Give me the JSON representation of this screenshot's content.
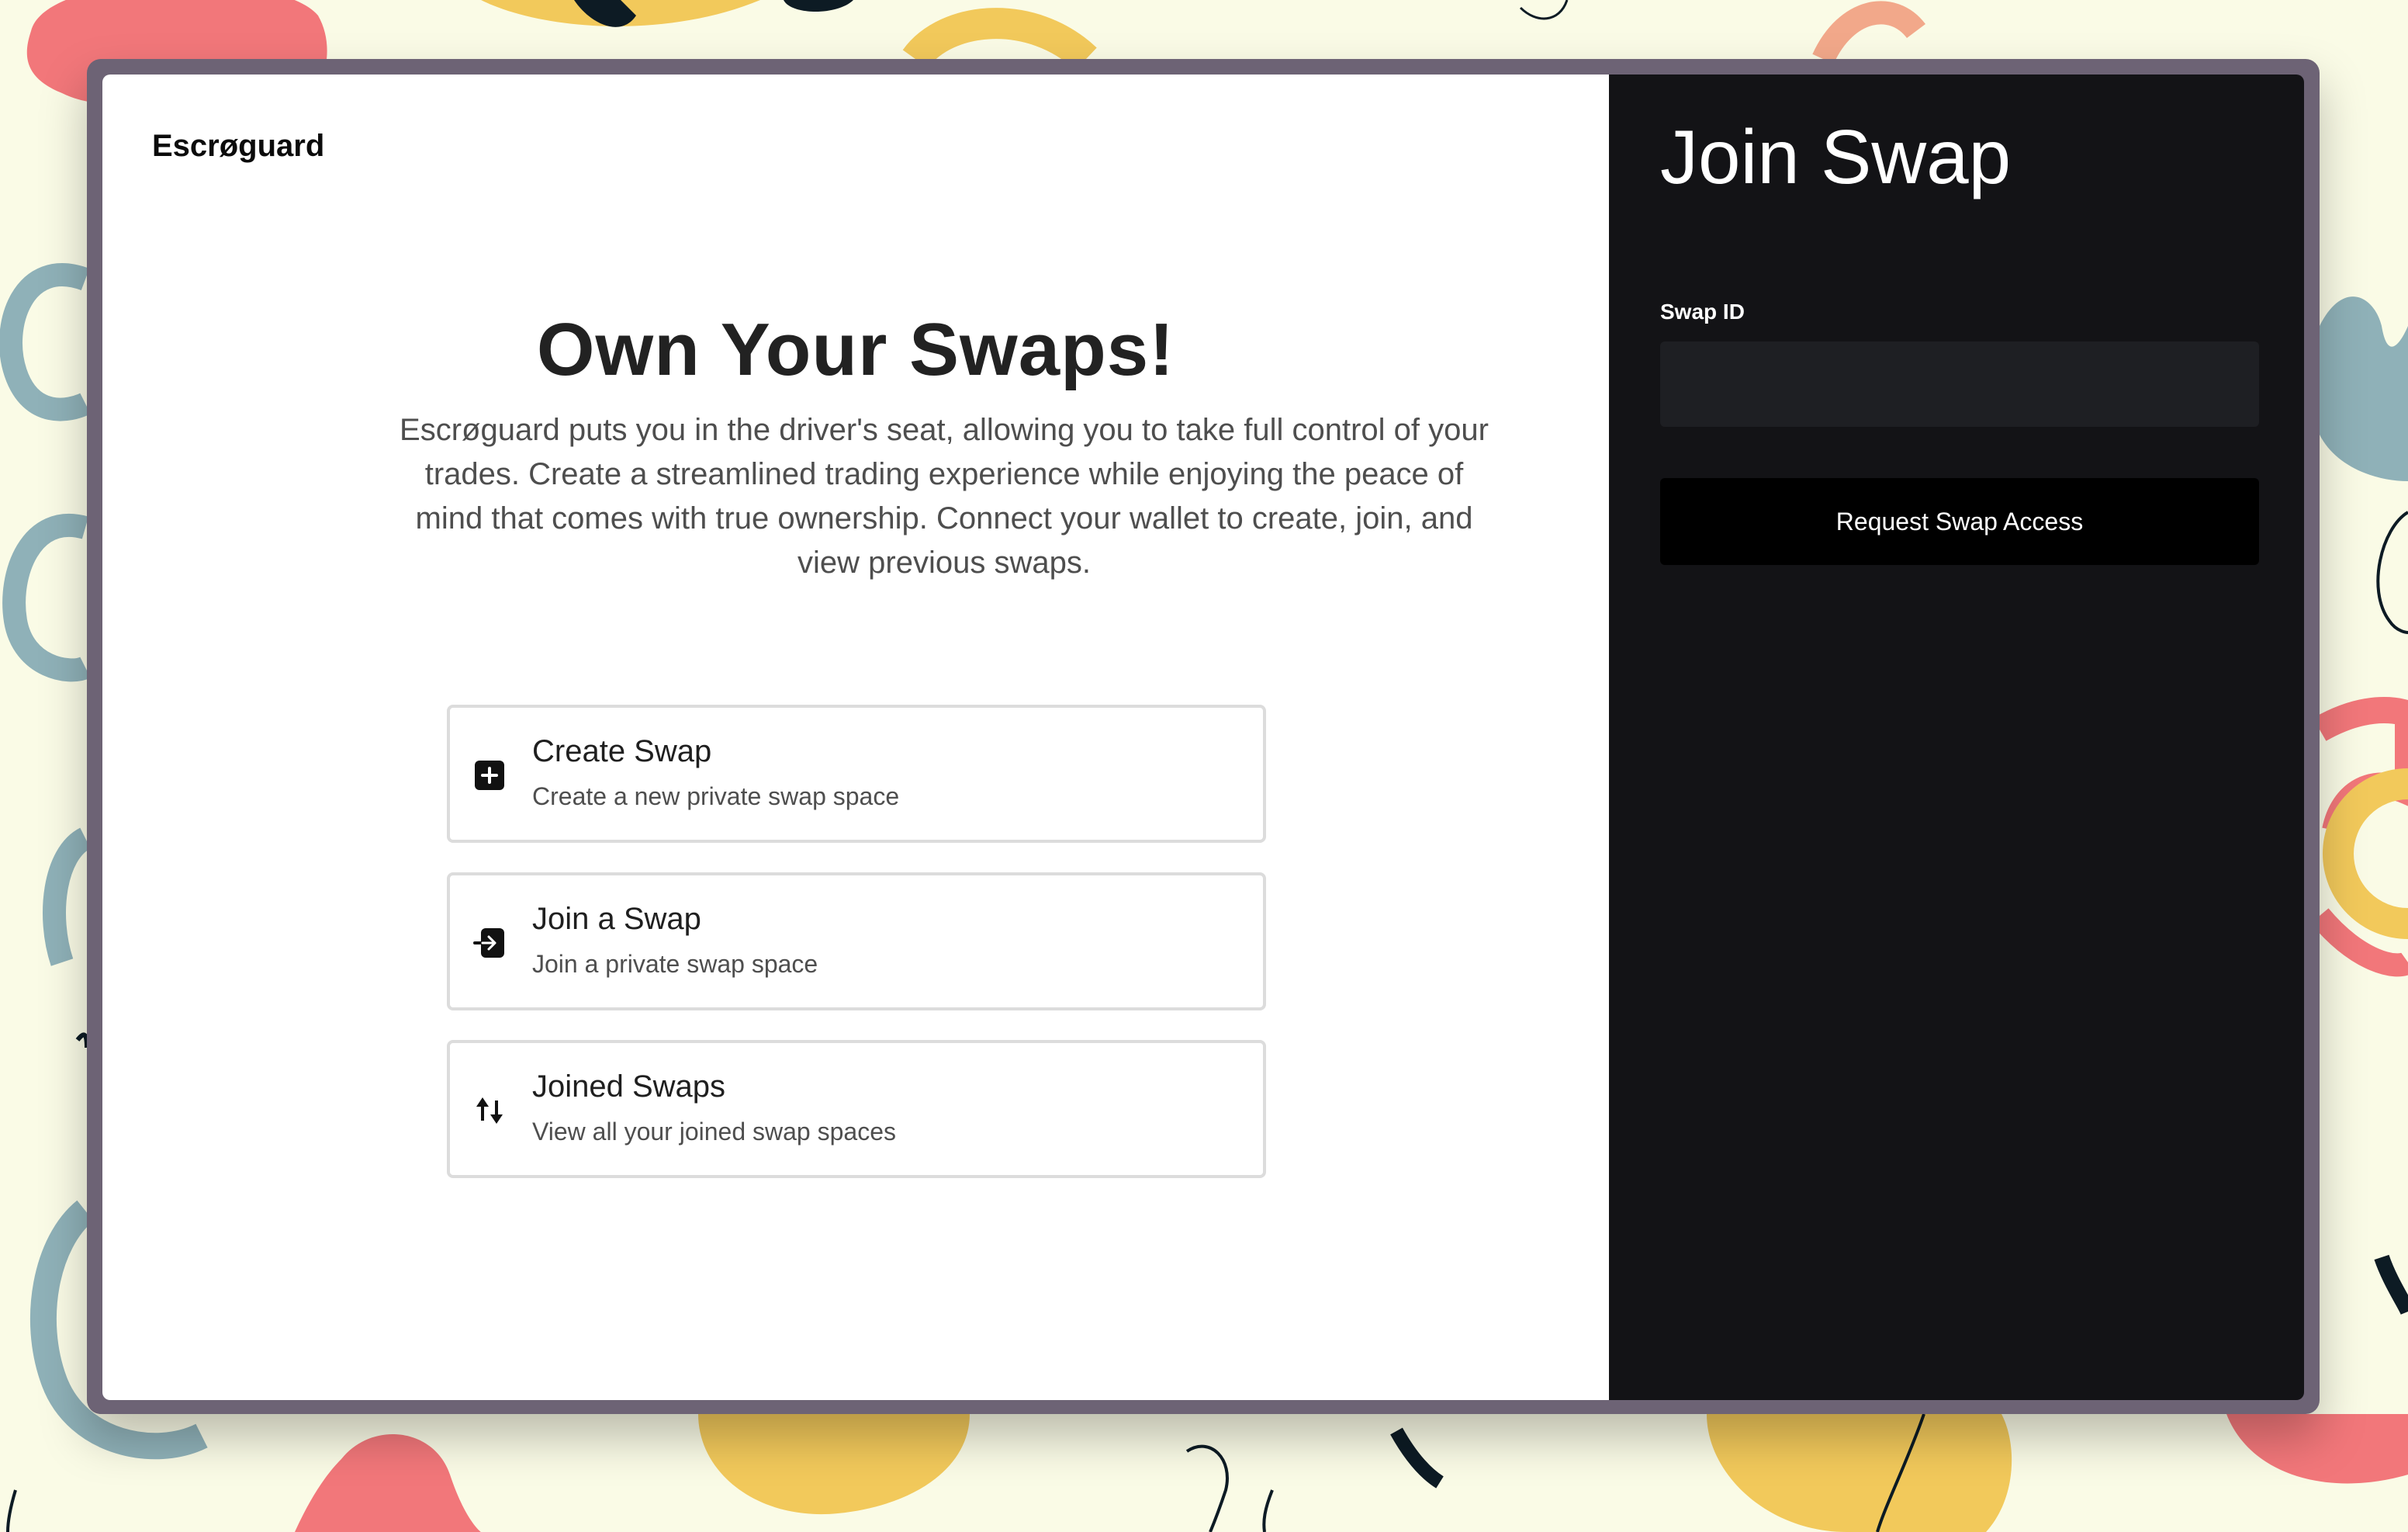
{
  "app": {
    "logo": "Escrøguard"
  },
  "hero": {
    "title": "Own Your Swaps!",
    "description": "Escrøguard puts you in the driver's seat, allowing you to take full control of your trades. Create a streamlined trading experience while enjoying the peace of mind that comes with true ownership. Connect your wallet to create, join, and view previous swaps."
  },
  "actions": [
    {
      "title": "Create Swap",
      "subtitle": "Create a new private swap space",
      "icon": "plus-square-icon"
    },
    {
      "title": "Join a Swap",
      "subtitle": "Join a private swap space",
      "icon": "enter-icon"
    },
    {
      "title": "Joined Swaps",
      "subtitle": "View all your joined swap spaces",
      "icon": "swap-arrows-icon"
    }
  ],
  "panel": {
    "title": "Join Swap",
    "field_label": "Swap ID",
    "swap_id_value": "",
    "submit_label": "Request Swap Access"
  },
  "colors": {
    "background": "#fafbe6",
    "window_frame": "#6d6375",
    "panel_bg": "#131316",
    "input_bg": "#1e1f23",
    "button_bg": "#000000"
  }
}
